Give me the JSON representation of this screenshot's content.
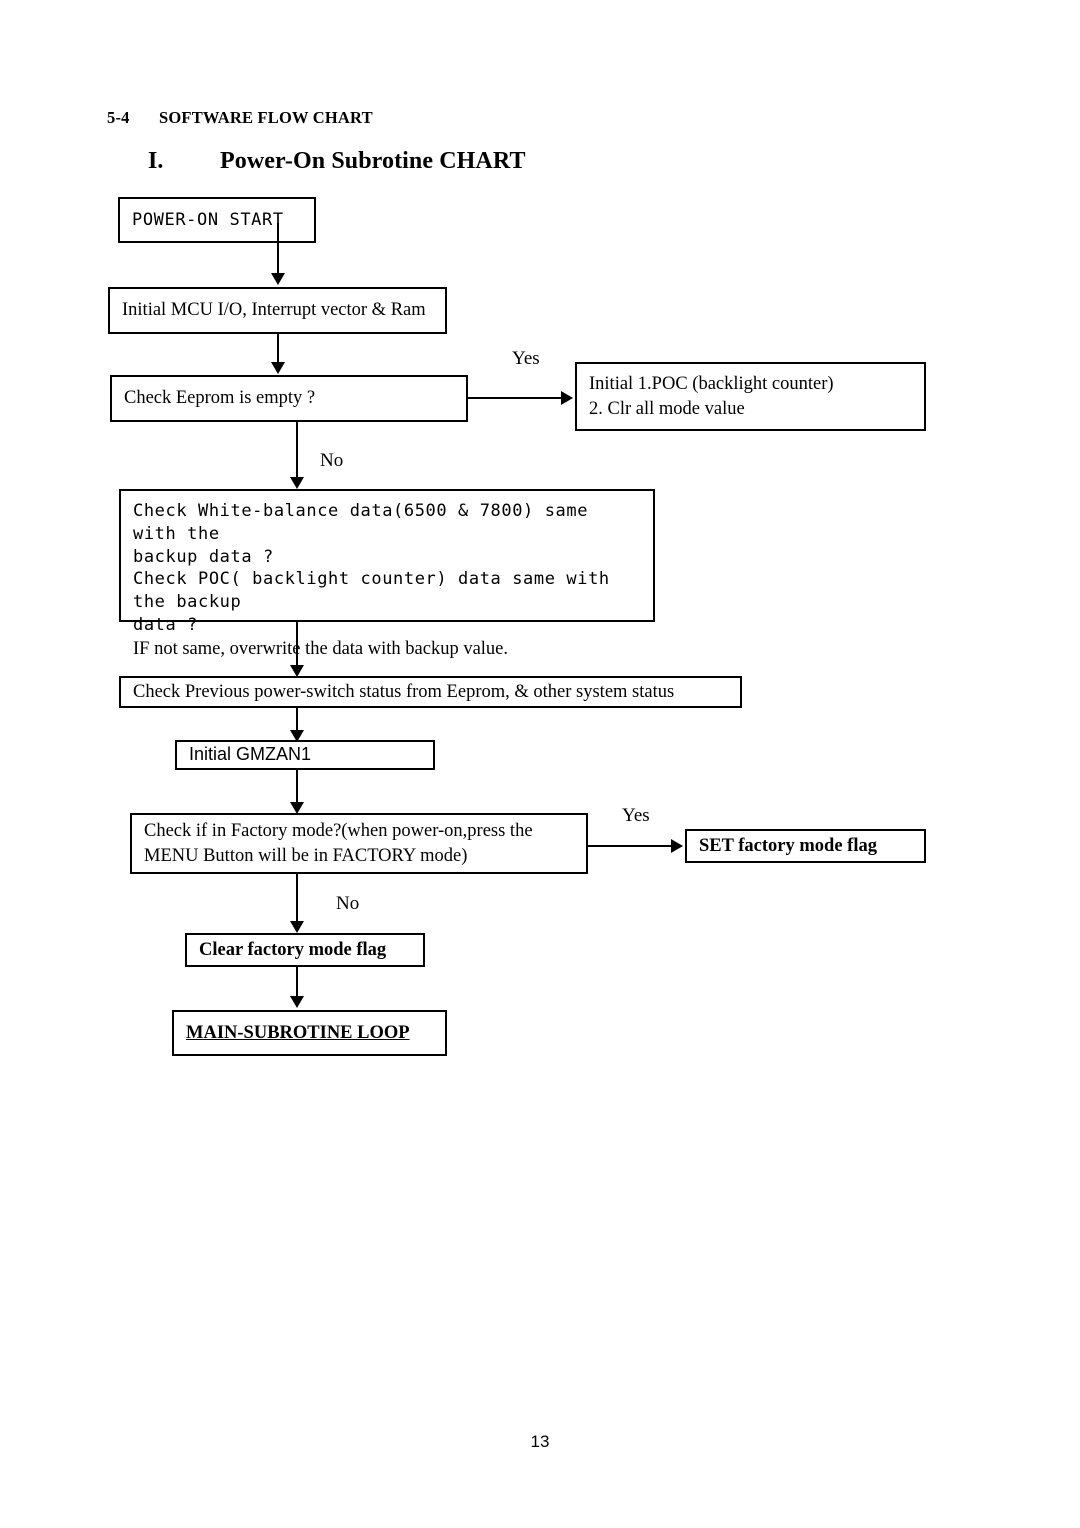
{
  "document": {
    "section_number": "5-4",
    "section_title": "SOFTWARE FLOW CHART",
    "chart_number": "I.",
    "chart_title": "Power-On Subrotine CHART",
    "page_number": "13"
  },
  "flowchart": {
    "nodes": {
      "power_on_start": "POWER-ON START",
      "init_mcu": "Initial MCU I/O, Interrupt vector & Ram",
      "check_eeprom": "Check Eeprom is empty ?",
      "init_poc_line1": "Initial 1.POC (backlight counter)",
      "init_poc_line2": "2. Clr all mode value",
      "check_wb_line1": "Check White-balance data(6500 & 7800) same with the",
      "check_wb_line2": "backup data ?",
      "check_wb_line3": "Check POC( backlight counter) data same with the backup",
      "check_wb_line4": "data ?",
      "check_wb_line5": "IF not same, overwrite the data with backup value.",
      "check_previous": "Check Previous power-switch status from Eeprom, & other system status",
      "init_gmzan": "Initial GMZAN1",
      "check_factory_line1": "Check if in Factory mode?(when power-on,press the",
      "check_factory_line2": "MENU Button will be in FACTORY mode)",
      "set_factory_flag": "SET factory mode flag",
      "clear_factory_flag": "Clear factory mode flag",
      "main_loop": "MAIN-SUBROTINE LOOP"
    },
    "edge_labels": {
      "eeprom_yes": "Yes",
      "eeprom_no": "No",
      "factory_yes": "Yes",
      "factory_no": "No"
    },
    "colors": {
      "stroke": "#000000",
      "background": "#ffffff",
      "text": "#000000"
    }
  }
}
